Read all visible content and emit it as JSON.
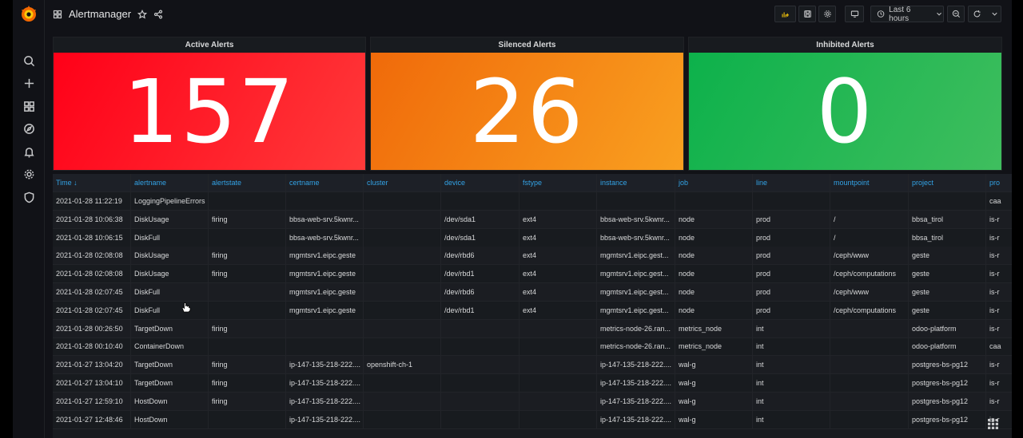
{
  "dashboard": {
    "title": "Alertmanager"
  },
  "toolbar": {
    "time_range": "Last 6 hours"
  },
  "sidemenu": {
    "icons": [
      "search-icon",
      "plus-icon",
      "dashboards-icon",
      "explore-icon",
      "alerting-icon",
      "configuration-icon",
      "shield-icon"
    ]
  },
  "panels": [
    {
      "title": "Active Alerts",
      "value": "157",
      "color_from": "#ff0018",
      "color_to": "#ff3a3a"
    },
    {
      "title": "Silenced Alerts",
      "value": "26",
      "color_from": "#f06a0a",
      "color_to": "#f9a020"
    },
    {
      "title": "Inhibited Alerts",
      "value": "0",
      "color_from": "#0db14b",
      "color_to": "#3fbe5e"
    }
  ],
  "table": {
    "columns": [
      "Time",
      "alertname",
      "alertstate",
      "certname",
      "cluster",
      "device",
      "fstype",
      "instance",
      "job",
      "line",
      "mountpoint",
      "project",
      "pro"
    ],
    "rows": [
      [
        "2021-01-28 11:22:19",
        "LoggingPipelineErrors",
        "",
        "",
        "",
        "",
        "",
        "",
        "",
        "",
        "",
        "",
        "caa"
      ],
      [
        "2021-01-28 10:06:38",
        "DiskUsage",
        "firing",
        "bbsa-web-srv.5kwnr...",
        "",
        "/dev/sda1",
        "ext4",
        "bbsa-web-srv.5kwnr...",
        "node",
        "prod",
        "/",
        "bbsa_tirol",
        "is-r"
      ],
      [
        "2021-01-28 10:06:15",
        "DiskFull",
        "",
        "bbsa-web-srv.5kwnr...",
        "",
        "/dev/sda1",
        "ext4",
        "bbsa-web-srv.5kwnr...",
        "node",
        "prod",
        "/",
        "bbsa_tirol",
        "is-r"
      ],
      [
        "2021-01-28 02:08:08",
        "DiskUsage",
        "firing",
        "mgmtsrv1.eipc.geste",
        "",
        "/dev/rbd6",
        "ext4",
        "mgmtsrv1.eipc.gest...",
        "node",
        "prod",
        "/ceph/www",
        "geste",
        "is-r"
      ],
      [
        "2021-01-28 02:08:08",
        "DiskUsage",
        "firing",
        "mgmtsrv1.eipc.geste",
        "",
        "/dev/rbd1",
        "ext4",
        "mgmtsrv1.eipc.gest...",
        "node",
        "prod",
        "/ceph/computations",
        "geste",
        "is-r"
      ],
      [
        "2021-01-28 02:07:45",
        "DiskFull",
        "",
        "mgmtsrv1.eipc.geste",
        "",
        "/dev/rbd6",
        "ext4",
        "mgmtsrv1.eipc.gest...",
        "node",
        "prod",
        "/ceph/www",
        "geste",
        "is-r"
      ],
      [
        "2021-01-28 02:07:45",
        "DiskFull",
        "",
        "mgmtsrv1.eipc.geste",
        "",
        "/dev/rbd1",
        "ext4",
        "mgmtsrv1.eipc.gest...",
        "node",
        "prod",
        "/ceph/computations",
        "geste",
        "is-r"
      ],
      [
        "2021-01-28 00:26:50",
        "TargetDown",
        "firing",
        "",
        "",
        "",
        "",
        "metrics-node-26.ran...",
        "metrics_node",
        "int",
        "",
        "odoo-platform",
        "is-r"
      ],
      [
        "2021-01-28 00:10:40",
        "ContainerDown",
        "",
        "",
        "",
        "",
        "",
        "metrics-node-26.ran...",
        "metrics_node",
        "int",
        "",
        "odoo-platform",
        "caa"
      ],
      [
        "2021-01-27 13:04:20",
        "TargetDown",
        "firing",
        "ip-147-135-218-222....",
        "openshift-ch-1",
        "",
        "",
        "ip-147-135-218-222....",
        "wal-g",
        "int",
        "",
        "postgres-bs-pg12",
        "is-r"
      ],
      [
        "2021-01-27 13:04:10",
        "TargetDown",
        "firing",
        "ip-147-135-218-222....",
        "",
        "",
        "",
        "ip-147-135-218-222....",
        "wal-g",
        "int",
        "",
        "postgres-bs-pg12",
        "is-r"
      ],
      [
        "2021-01-27 12:59:10",
        "HostDown",
        "firing",
        "ip-147-135-218-222....",
        "",
        "",
        "",
        "ip-147-135-218-222....",
        "wal-g",
        "int",
        "",
        "postgres-bs-pg12",
        "is-r"
      ],
      [
        "2021-01-27 12:48:46",
        "HostDown",
        "",
        "ip-147-135-218-222....",
        "",
        "",
        "",
        "ip-147-135-218-222....",
        "wal-g",
        "int",
        "",
        "postgres-bs-pg12",
        "is-r"
      ]
    ]
  }
}
